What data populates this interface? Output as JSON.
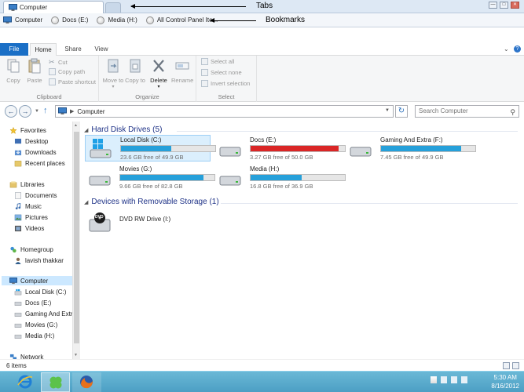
{
  "tabs": {
    "active_tab_label": "Computer",
    "annotation_label": "Tabs"
  },
  "window_controls": {
    "minimize": "—",
    "restore": "□",
    "close": "✕"
  },
  "bookmarks": {
    "annotation_label": "Bookmarks",
    "items": [
      {
        "label": "Computer",
        "icon": "computer-icon"
      },
      {
        "label": "Docs (E:)",
        "icon": "drive-icon"
      },
      {
        "label": "Media (H:)",
        "icon": "drive-icon"
      },
      {
        "label": "All Control Panel Ite...",
        "icon": "control-panel-icon"
      }
    ]
  },
  "ribbon": {
    "tabs": [
      "File",
      "Home",
      "Share",
      "View"
    ],
    "active_tab": "Home",
    "clipboard": {
      "copy": "Copy",
      "paste": "Paste",
      "cut": "Cut",
      "copy_path": "Copy path",
      "paste_shortcut": "Paste shortcut",
      "label": "Clipboard"
    },
    "organize": {
      "move_to": "Move to",
      "copy_to": "Copy to",
      "delete": "Delete",
      "rename": "Rename",
      "label": "Organize"
    },
    "select": {
      "select_all": "Select all",
      "select_none": "Select none",
      "invert_selection": "Invert selection",
      "label": "Select"
    },
    "move_arrow": "▾",
    "delete_arrow": "▾"
  },
  "address": {
    "path": "Computer",
    "search_placeholder": "Search Computer",
    "back": "←",
    "forward": "→",
    "up": "↑",
    "refresh": "↻"
  },
  "nav": {
    "favorites": "Favorites",
    "desktop": "Desktop",
    "downloads": "Downloads",
    "recent": "Recent places",
    "libraries": "Libraries",
    "documents": "Documents",
    "music": "Music",
    "pictures": "Pictures",
    "videos": "Videos",
    "homegroup": "Homegroup",
    "user": "lavish thakkar",
    "computer": "Computer",
    "local_disk": "Local Disk (C:)",
    "docs": "Docs (E:)",
    "gaming": "Gaming And Extr",
    "movies": "Movies (G:)",
    "media": "Media (H:)",
    "network": "Network"
  },
  "content": {
    "hard_disk_header": "Hard Disk Drives (5)",
    "removable_header": "Devices with Removable Storage (1)",
    "drives": [
      {
        "name": "Local Disk (C:)",
        "free": "23.6 GB free of 49.9 GB",
        "used_fraction": 0.53,
        "full": false,
        "windows": true
      },
      {
        "name": "Docs (E:)",
        "free": "3.27 GB free of 50.0 GB",
        "used_fraction": 0.93,
        "full": true,
        "windows": false
      },
      {
        "name": "Gaming And Extra (F:)",
        "free": "7.45 GB free of 49.9 GB",
        "used_fraction": 0.85,
        "full": false,
        "windows": false
      },
      {
        "name": "Movies (G:)",
        "free": "9.66 GB free of 82.8 GB",
        "used_fraction": 0.88,
        "full": false,
        "windows": false
      },
      {
        "name": "Media (H:)",
        "free": "16.8 GB free of 36.9 GB",
        "used_fraction": 0.54,
        "full": false,
        "windows": false
      }
    ],
    "dvd": {
      "name": "DVD RW Drive (I:)",
      "badge": "DVD"
    }
  },
  "status": {
    "count": "6 items"
  },
  "taskbar": {
    "time": "5:30 AM",
    "date": "8/16/2012"
  },
  "colors": {
    "drive_bar_normal": "#26a0da",
    "drive_bar_full": "#da2626",
    "file_tab": "#1a6fc6",
    "taskbar": "#4c9fc4"
  }
}
